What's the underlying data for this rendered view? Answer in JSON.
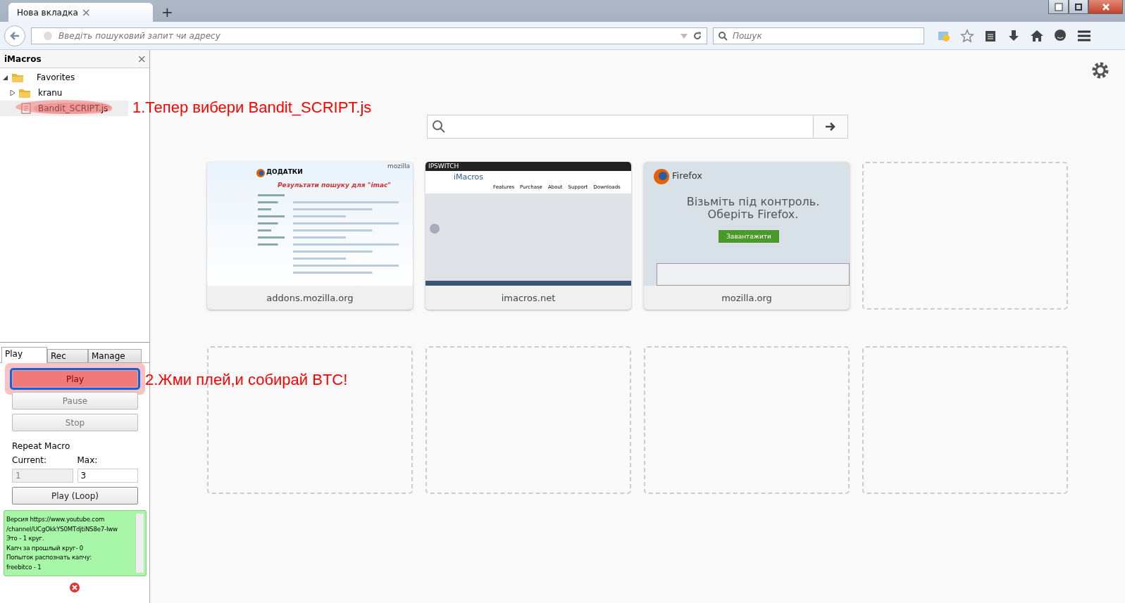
{
  "window": {
    "tabs": [
      {
        "title": "Нова вкладка",
        "close": "×",
        "selected": true
      }
    ],
    "new_tab": "+"
  },
  "toolbar": {
    "address_placeholder": "Введіть пошуковий запит чи адресу",
    "search_placeholder": "Пошук"
  },
  "sidebar": {
    "title": "iMacros",
    "close": "×",
    "tree": [
      {
        "label": "Favorites",
        "kind": "folder",
        "expanded": true,
        "selected": false,
        "children": [
          {
            "label": "kranu",
            "kind": "folder",
            "expanded": false,
            "selected": false
          },
          {
            "label": "Bandit_SCRIPT.js",
            "kind": "script",
            "selected": true
          }
        ]
      }
    ],
    "tabs": [
      {
        "label": "Play",
        "selected": true
      },
      {
        "label": "Rec",
        "selected": false
      },
      {
        "label": "Manage",
        "selected": false
      }
    ],
    "buttons": [
      {
        "label": "Play",
        "disabled": false,
        "focused": true
      },
      {
        "label": "Pause",
        "disabled": true,
        "focused": false
      },
      {
        "label": "Stop",
        "disabled": true,
        "focused": false
      }
    ],
    "repeat_label": "Repeat Macro",
    "current_label": "Current:",
    "max_label": "Max:",
    "current_value": "1",
    "max_value": "3",
    "loop_button": "Play (Loop)",
    "log": [
      "Версия  https://www.youtube.com",
      "/channel/UCgOkkYS0MTdjtiNS8e7-Iww",
      "Это - 1 круг.",
      "Капч за прошлый круг- 0",
      "Попыток распознать капчу:",
      "freebitco - 1"
    ]
  },
  "annotations": [
    {
      "text": "1.Тепер вибери Bandit_SCRIPT.js"
    },
    {
      "text": "2.Жми плей,и собирай BTC!"
    }
  ],
  "tiles": [
    {
      "kind": "addons",
      "caption": "addons.mozilla.org",
      "heading": "ДОДАТКИ",
      "subheading": "Результати пошуку для \"imac\"",
      "brand": "mozilla"
    },
    {
      "kind": "imacros",
      "caption": "imacros.net",
      "heading": "iMacros",
      "brand": "IPSWITCH",
      "menu": [
        "Features",
        "Purchase",
        "About",
        "Support",
        "Downloads"
      ]
    },
    {
      "kind": "firefox",
      "caption": "mozilla.org",
      "heading": "Firefox",
      "subheading": "Візьміть під контроль. Оберіть Firefox.",
      "button": "Завантажити"
    },
    {
      "kind": "empty"
    },
    {
      "kind": "empty"
    },
    {
      "kind": "empty"
    },
    {
      "kind": "empty"
    },
    {
      "kind": "empty"
    }
  ]
}
